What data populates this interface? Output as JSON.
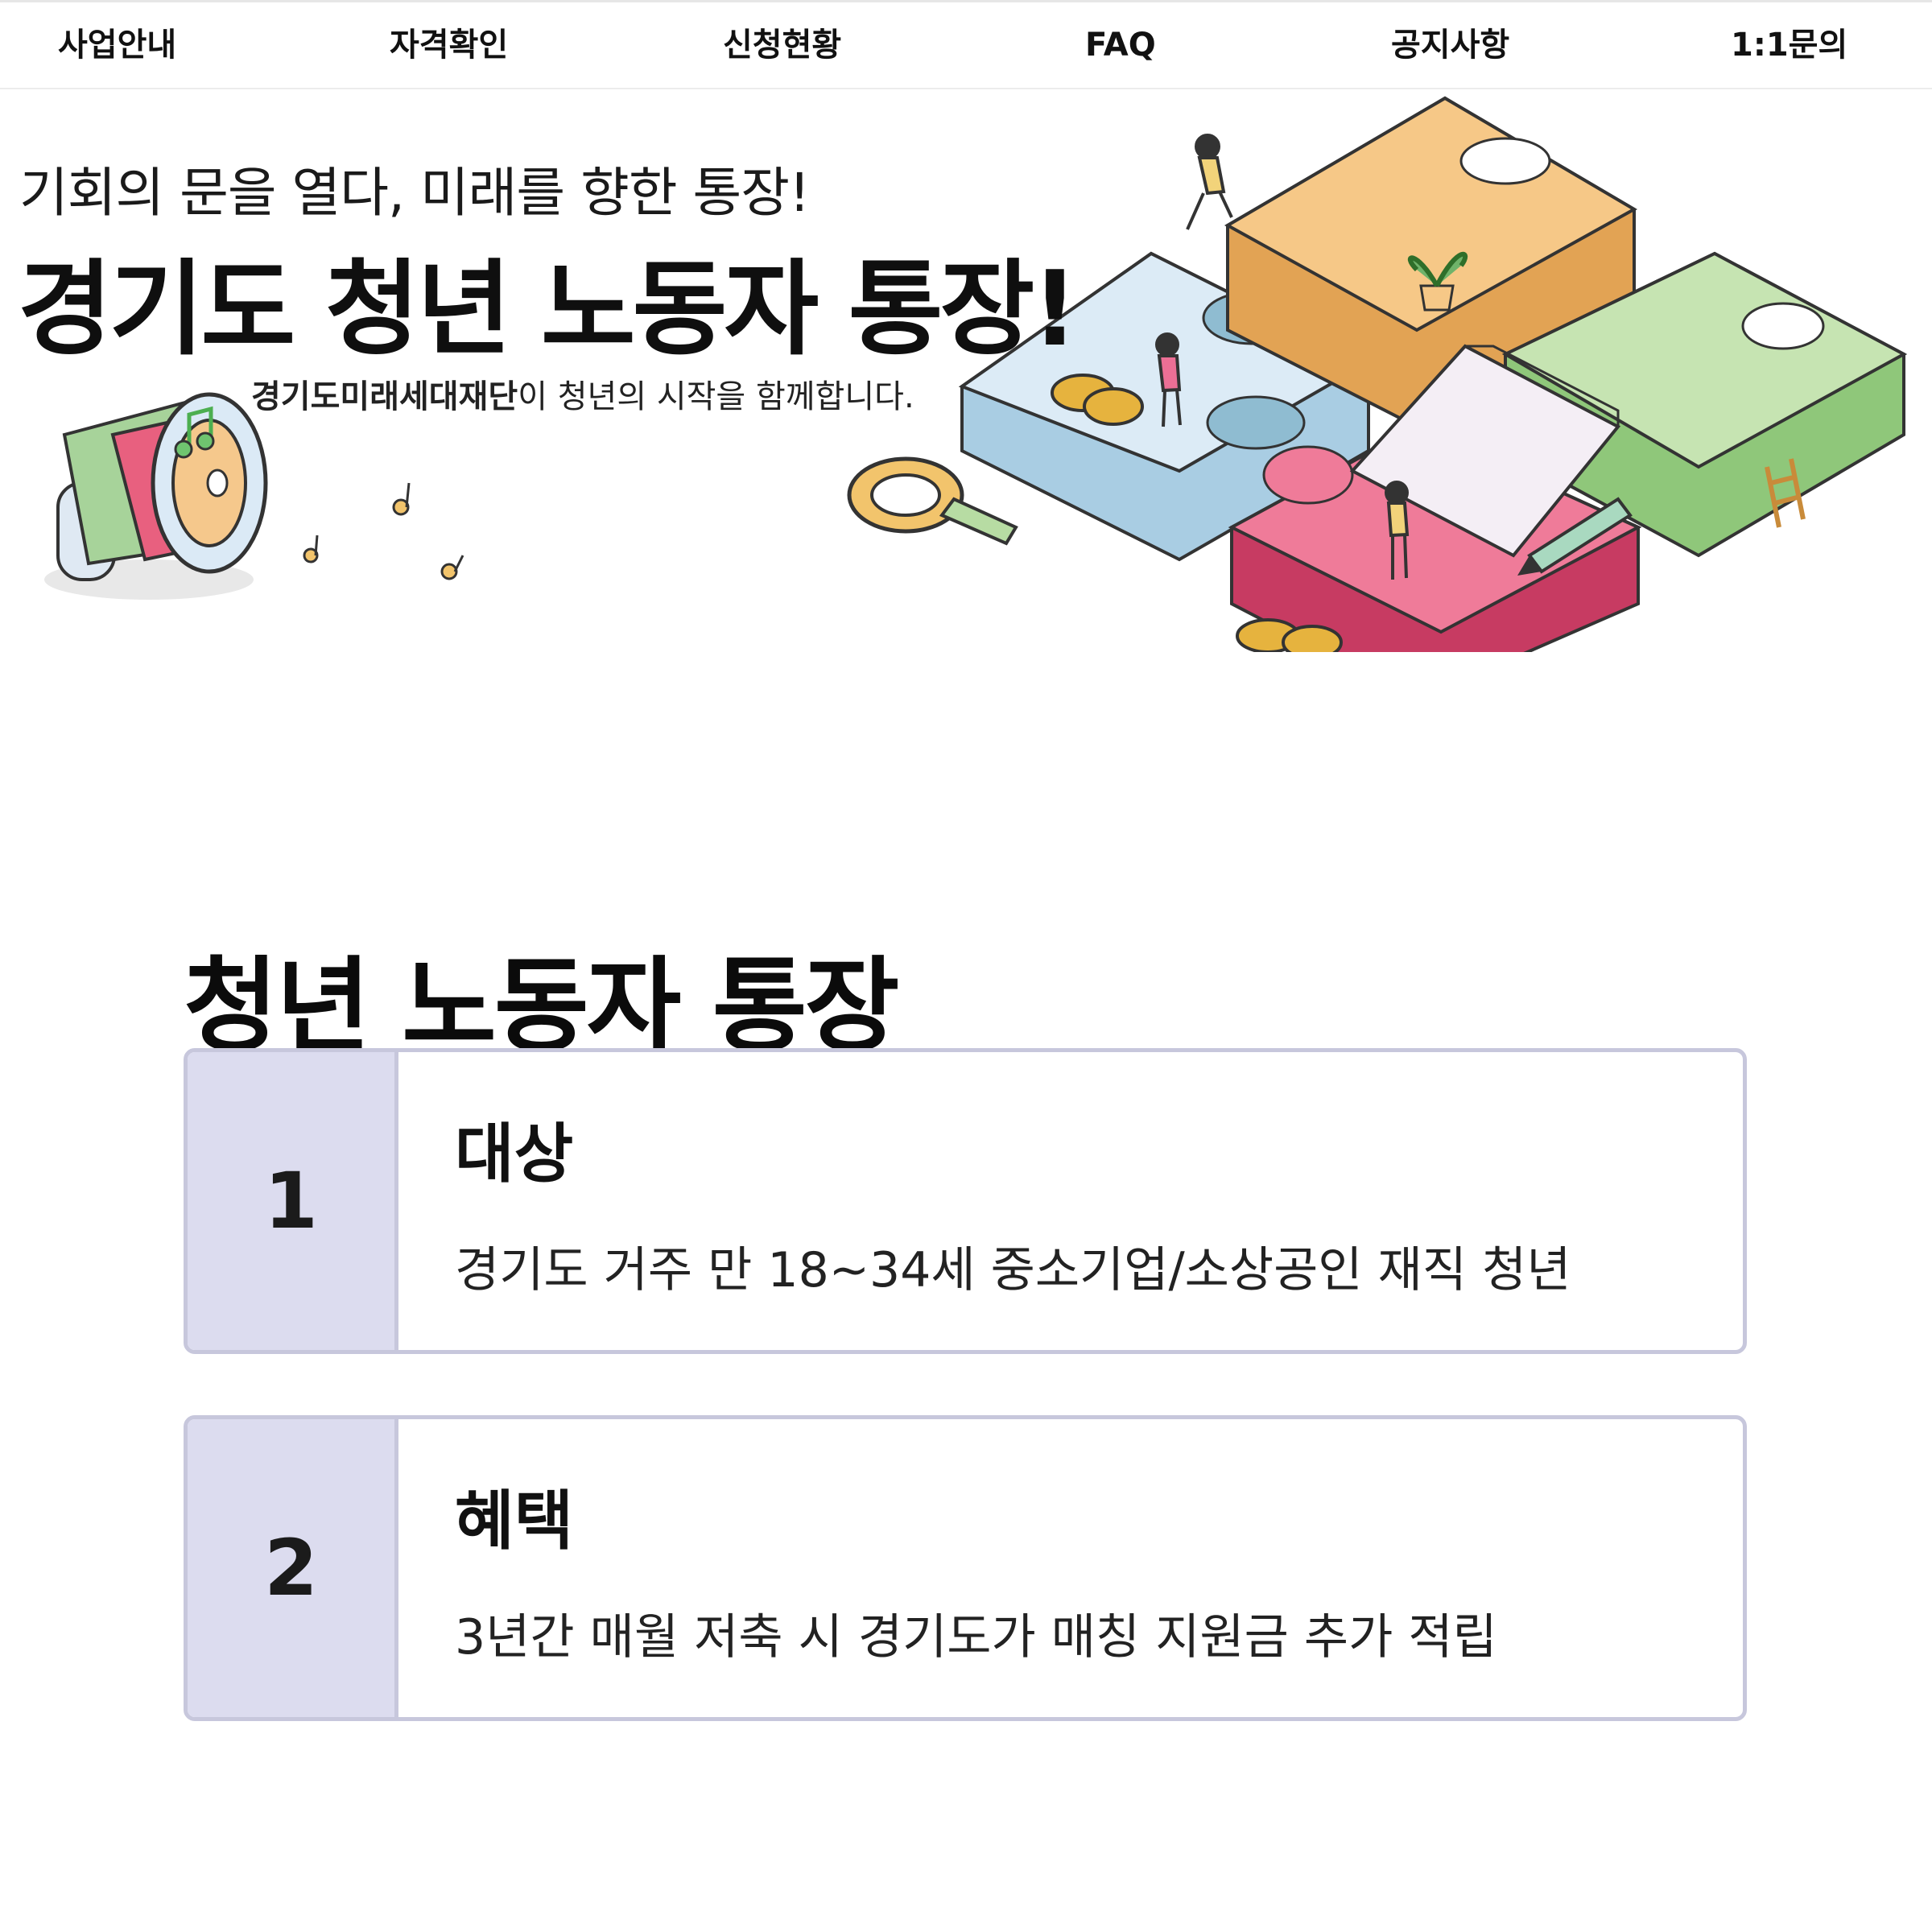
{
  "nav": {
    "items": [
      "사업안내",
      "자격확인",
      "신청현황",
      "FAQ",
      "공지사항",
      "1:1문의"
    ]
  },
  "hero": {
    "subtitle": "기회의 문을 열다, 미래를 향한 통장!",
    "title": "경기도 청년 노동자 통장!",
    "caption_org": "경기도미래세대재단",
    "caption_rest": "이 청년의 시작을 함께합니다."
  },
  "section": {
    "title": "청년 노동자 통장",
    "cards": [
      {
        "number": "1",
        "heading": "대상",
        "body": "경기도 거주 만 18~34세 중소기업/소상공인 재직 청년"
      },
      {
        "number": "2",
        "heading": "혜택",
        "body": "3년간 매월 저축 시 경기도가 매칭 지원금 추가 적립"
      }
    ]
  },
  "colors": {
    "card_accent": "#dcdcef",
    "card_border": "#c7c7dc",
    "puzzle_orange": "#f3c27a",
    "puzzle_blue": "#cfe4f2",
    "puzzle_green": "#b8dc9f",
    "puzzle_pink": "#e6557a"
  }
}
